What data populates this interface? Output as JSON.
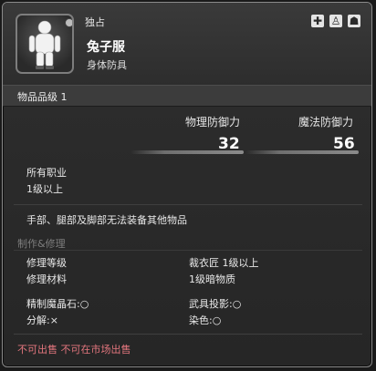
{
  "header": {
    "tag": "独占",
    "name": "兔子服",
    "type": "身体防具"
  },
  "item_level": "物品品级 1",
  "stats": {
    "physical_label": "物理防御力",
    "physical_value": "32",
    "magic_label": "魔法防御力",
    "magic_value": "56"
  },
  "classes": {
    "jobs": "所有职业",
    "level": "1级以上"
  },
  "restriction": "手部、腿部及脚部无法装备其他物品",
  "crafting": {
    "title": "制作&修理",
    "repair_level_label": "修理等级",
    "repair_level_value": "裁衣匠 1级以上",
    "repair_material_label": "修理材料",
    "repair_material_value": "1级暗物质",
    "materia": "精制魔晶石:○",
    "glamour": "武具投影:○",
    "desynth": "分解:×",
    "dye": "染色:○"
  },
  "market": "不可出售 不可在市场出售",
  "icons": [
    "equip-cross-icon",
    "armoury-icon",
    "retainer-icon"
  ],
  "colors": {
    "accent_red": "#e2757d",
    "section_grey": "#7e7e7e"
  }
}
